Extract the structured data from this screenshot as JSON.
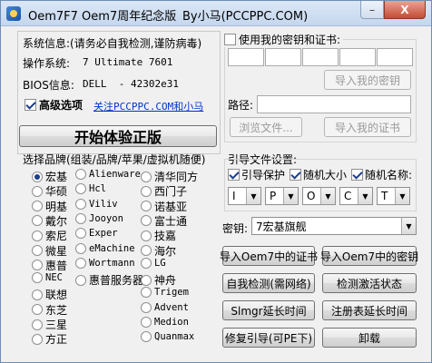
{
  "window": {
    "title": "Oem7F7 Oem7周年纪念版",
    "author": "By小马(PCCPPC.COM)",
    "min_glyph": "–",
    "close_glyph": "X"
  },
  "sysinfo": {
    "header": "系统信息:(请务必自我检测,谨防病毒)",
    "os_label": "操作系统:",
    "os_value": "7 Ultimate 7601",
    "bios_label": "BIOS信息:",
    "bios_value": "DELL  - 42302e31",
    "advanced_label": "高级选项",
    "advanced_checked": true,
    "follow_link": "关注PCCPPC.COM和小马"
  },
  "start_button": "开始体验正版",
  "brand_header": "选择品牌(组装/品牌/苹果/虚拟机随便)",
  "brands": [
    {
      "label": "宏基",
      "mono": false,
      "checked": true
    },
    {
      "label": "华硕",
      "mono": false,
      "checked": false
    },
    {
      "label": "明基",
      "mono": false,
      "checked": false
    },
    {
      "label": "戴尔",
      "mono": false,
      "checked": false
    },
    {
      "label": "索尼",
      "mono": false,
      "checked": false
    },
    {
      "label": "微星",
      "mono": false,
      "checked": false
    },
    {
      "label": "惠普",
      "mono": false,
      "checked": false
    },
    {
      "label": "NEC",
      "mono": true,
      "checked": false
    },
    {
      "label": "联想",
      "mono": false,
      "checked": false
    },
    {
      "label": "东芝",
      "mono": false,
      "checked": false
    },
    {
      "label": "三星",
      "mono": false,
      "checked": false
    },
    {
      "label": "方正",
      "mono": false,
      "checked": false
    },
    {
      "label": "Alienware",
      "mono": true,
      "checked": false
    },
    {
      "label": "Hcl",
      "mono": true,
      "checked": false
    },
    {
      "label": "Viliv",
      "mono": true,
      "checked": false
    },
    {
      "label": "Jooyon",
      "mono": true,
      "checked": false
    },
    {
      "label": "Exper",
      "mono": true,
      "checked": false
    },
    {
      "label": "eMachine",
      "mono": true,
      "checked": false
    },
    {
      "label": "Wortmann",
      "mono": true,
      "checked": false
    },
    {
      "label": "惠普服务器",
      "mono": false,
      "checked": false
    },
    {
      "label": "清华同方",
      "mono": false,
      "checked": false
    },
    {
      "label": "西门子",
      "mono": false,
      "checked": false
    },
    {
      "label": "诺基亚",
      "mono": false,
      "checked": false
    },
    {
      "label": "富士通",
      "mono": false,
      "checked": false
    },
    {
      "label": "技嘉",
      "mono": false,
      "checked": false
    },
    {
      "label": "海尔",
      "mono": false,
      "checked": false
    },
    {
      "label": "LG",
      "mono": true,
      "checked": false
    },
    {
      "label": "神舟",
      "mono": false,
      "checked": false
    },
    {
      "label": "Trigem",
      "mono": true,
      "checked": false
    },
    {
      "label": "Advent",
      "mono": true,
      "checked": false
    },
    {
      "label": "Medion",
      "mono": true,
      "checked": false
    },
    {
      "label": "Quanmax",
      "mono": true,
      "checked": false
    }
  ],
  "key_cert": {
    "use_label": "使用我的密钥和证书:",
    "use_checked": false,
    "key_segments": [
      "",
      "",
      "",
      "",
      ""
    ],
    "import_key": "导入我的密钥",
    "path_label": "路径:",
    "path_value": "",
    "browse": "浏览文件...",
    "import_cert": "导入我的证书"
  },
  "boot": {
    "header": "引导文件设置:",
    "opts": [
      {
        "label": "引导保护",
        "checked": true
      },
      {
        "label": "随机大小",
        "checked": true
      },
      {
        "label": "随机名称:",
        "checked": true
      }
    ],
    "letters": [
      "I",
      "P",
      "O",
      "C",
      "T"
    ]
  },
  "key_select": {
    "label": "密钥:",
    "value": "7宏基旗舰"
  },
  "actions": {
    "import_oem_cert": "导入Oem7中的证书",
    "import_oem_key": "导入Oem7中的密钥",
    "self_check": "自我检测(需网络)",
    "check_status": "检测激活状态",
    "slmgr_extend": "Slmgr延长时间",
    "reg_extend": "注册表延长时间",
    "repair_boot": "修复引导(可PE下)",
    "uninstall": "卸载"
  }
}
